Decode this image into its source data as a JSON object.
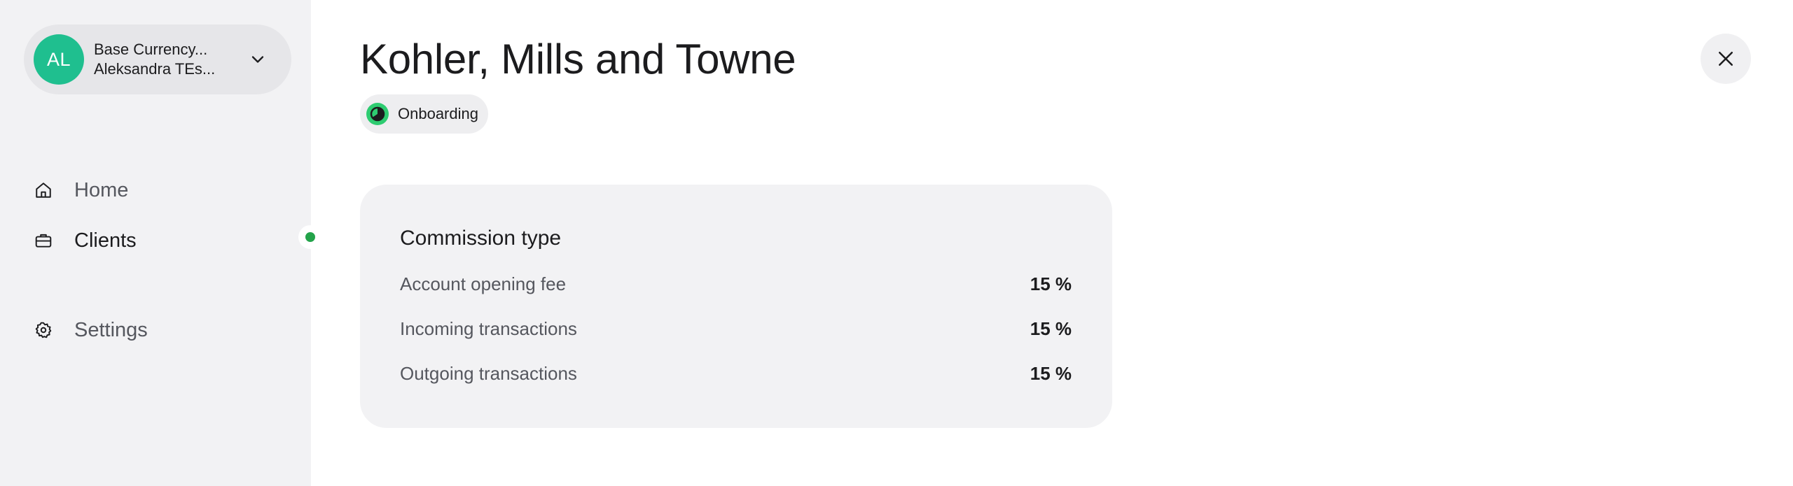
{
  "account": {
    "initials": "AL",
    "line1": "Base Currency...",
    "line2": "Aleksandra TEs...",
    "avatar_color": "#1fbf8f"
  },
  "nav": {
    "items": [
      {
        "label": "Home",
        "icon": "home-icon"
      },
      {
        "label": "Clients",
        "icon": "briefcase-icon",
        "active": true
      },
      {
        "label": "Settings",
        "icon": "gear-icon"
      }
    ]
  },
  "client": {
    "name": "Kohler, Mills and Towne",
    "status": "Onboarding",
    "status_color": "#2ecc71"
  },
  "commission": {
    "title": "Commission type",
    "rows": [
      {
        "label": "Account opening fee",
        "value": "15 %"
      },
      {
        "label": "Incoming transactions",
        "value": "15 %"
      },
      {
        "label": "Outgoing transactions",
        "value": "15 %"
      }
    ]
  },
  "colors": {
    "sidebar_bg": "#f2f2f4",
    "active_dot": "#23a34a"
  }
}
